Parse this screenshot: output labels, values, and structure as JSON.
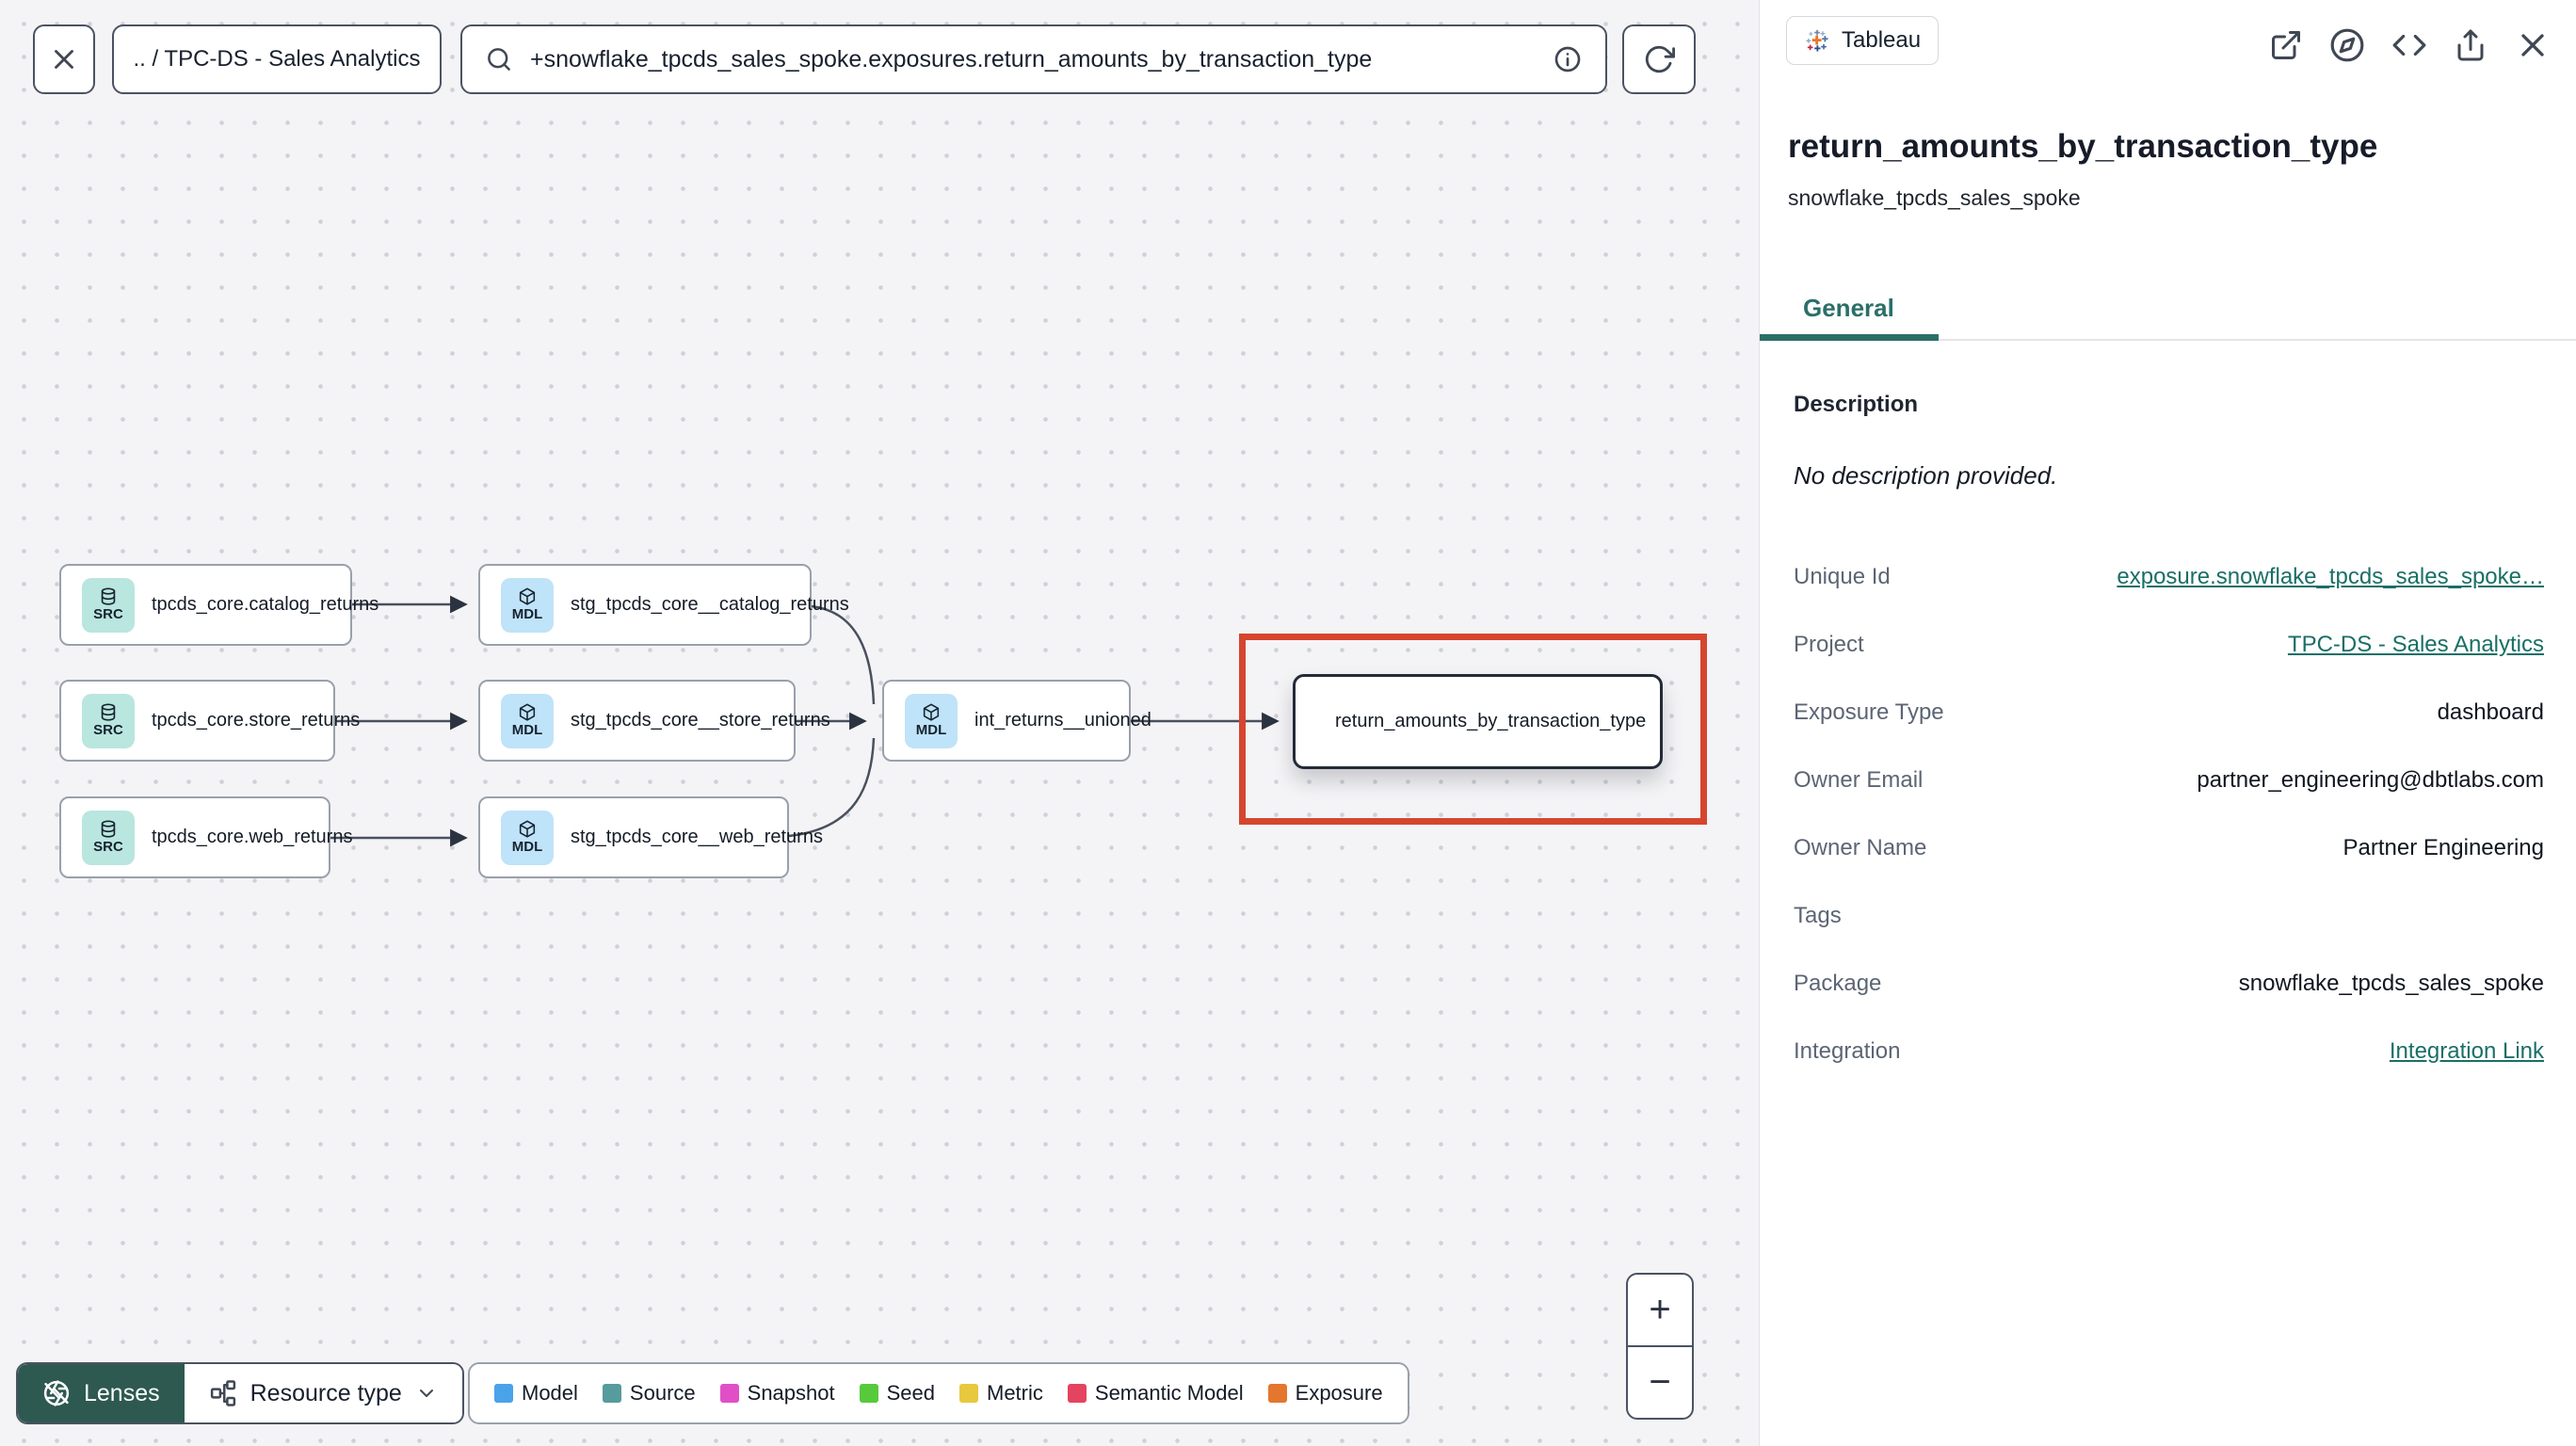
{
  "toolbar": {
    "breadcrumb": ".. / TPC-DS - Sales Analytics",
    "search_value": "+snowflake_tpcds_sales_spoke.exposures.return_amounts_by_transaction_type"
  },
  "graph": {
    "nodes": [
      {
        "badge": "SRC",
        "type": "source",
        "label": "tpcds_core.catalog_returns"
      },
      {
        "badge": "MDL",
        "type": "model",
        "label": "stg_tpcds_core__catalog_returns"
      },
      {
        "badge": "SRC",
        "type": "source",
        "label": "tpcds_core.store_returns"
      },
      {
        "badge": "MDL",
        "type": "model",
        "label": "stg_tpcds_core__store_returns"
      },
      {
        "badge": "MDL",
        "type": "model",
        "label": "int_returns__unioned"
      },
      {
        "badge": "SRC",
        "type": "source",
        "label": "tpcds_core.web_returns"
      },
      {
        "badge": "MDL",
        "type": "model",
        "label": "stg_tpcds_core__web_returns"
      },
      {
        "badge": "",
        "type": "exposure",
        "label": "return_amounts_by_transaction_type"
      }
    ],
    "highlight_color": "#d6452e"
  },
  "controls": {
    "lenses_label": "Lenses",
    "resource_type_label": "Resource type",
    "zoom_in": "+",
    "zoom_out": "−"
  },
  "legend": {
    "items": [
      {
        "label": "Model",
        "color": "#4aa2e9"
      },
      {
        "label": "Source",
        "color": "#579b9c"
      },
      {
        "label": "Snapshot",
        "color": "#e14fc6"
      },
      {
        "label": "Seed",
        "color": "#56ca3b"
      },
      {
        "label": "Metric",
        "color": "#e8c83d"
      },
      {
        "label": "Semantic Model",
        "color": "#e4445f"
      },
      {
        "label": "Exposure",
        "color": "#e5762e"
      }
    ]
  },
  "panel": {
    "integration_chip": "Tableau",
    "title": "return_amounts_by_transaction_type",
    "subtitle": "snowflake_tpcds_sales_spoke",
    "tab_general": "General",
    "description_header": "Description",
    "description_empty": "No description provided.",
    "fields": [
      {
        "label": "Unique Id",
        "value": "exposure.snowflake_tpcds_sales_spoke…"
      },
      {
        "label": "Project",
        "value": "TPC-DS - Sales Analytics"
      },
      {
        "label": "Exposure Type",
        "value": "dashboard"
      },
      {
        "label": "Owner Email",
        "value": "partner_engineering@dbtlabs.com"
      },
      {
        "label": "Owner Name",
        "value": "Partner Engineering"
      },
      {
        "label": "Tags",
        "value": ""
      },
      {
        "label": "Package",
        "value": "snowflake_tpcds_sales_spoke"
      },
      {
        "label": "Integration",
        "value": "Integration Link"
      }
    ],
    "accent_teal": "#2a6f68"
  },
  "icons": {
    "close-icon": "X cross",
    "search-icon": "magnifier",
    "info-icon": "circled i",
    "refresh-icon": "circular arrow",
    "database-icon": "stacked cylinders (source)",
    "cube-icon": "3d package (model)",
    "tableau-icon": "tableau plus-cluster logo",
    "lens-icon": "aperture",
    "sitemap-icon": "resource hierarchy",
    "chevron-down-icon": "v",
    "external-link-icon": "box with outgoing arrow",
    "compass-icon": "explore compass",
    "code-icon": "</>",
    "share-icon": "tray with up arrow",
    "plus-icon": "+",
    "minus-icon": "−"
  }
}
